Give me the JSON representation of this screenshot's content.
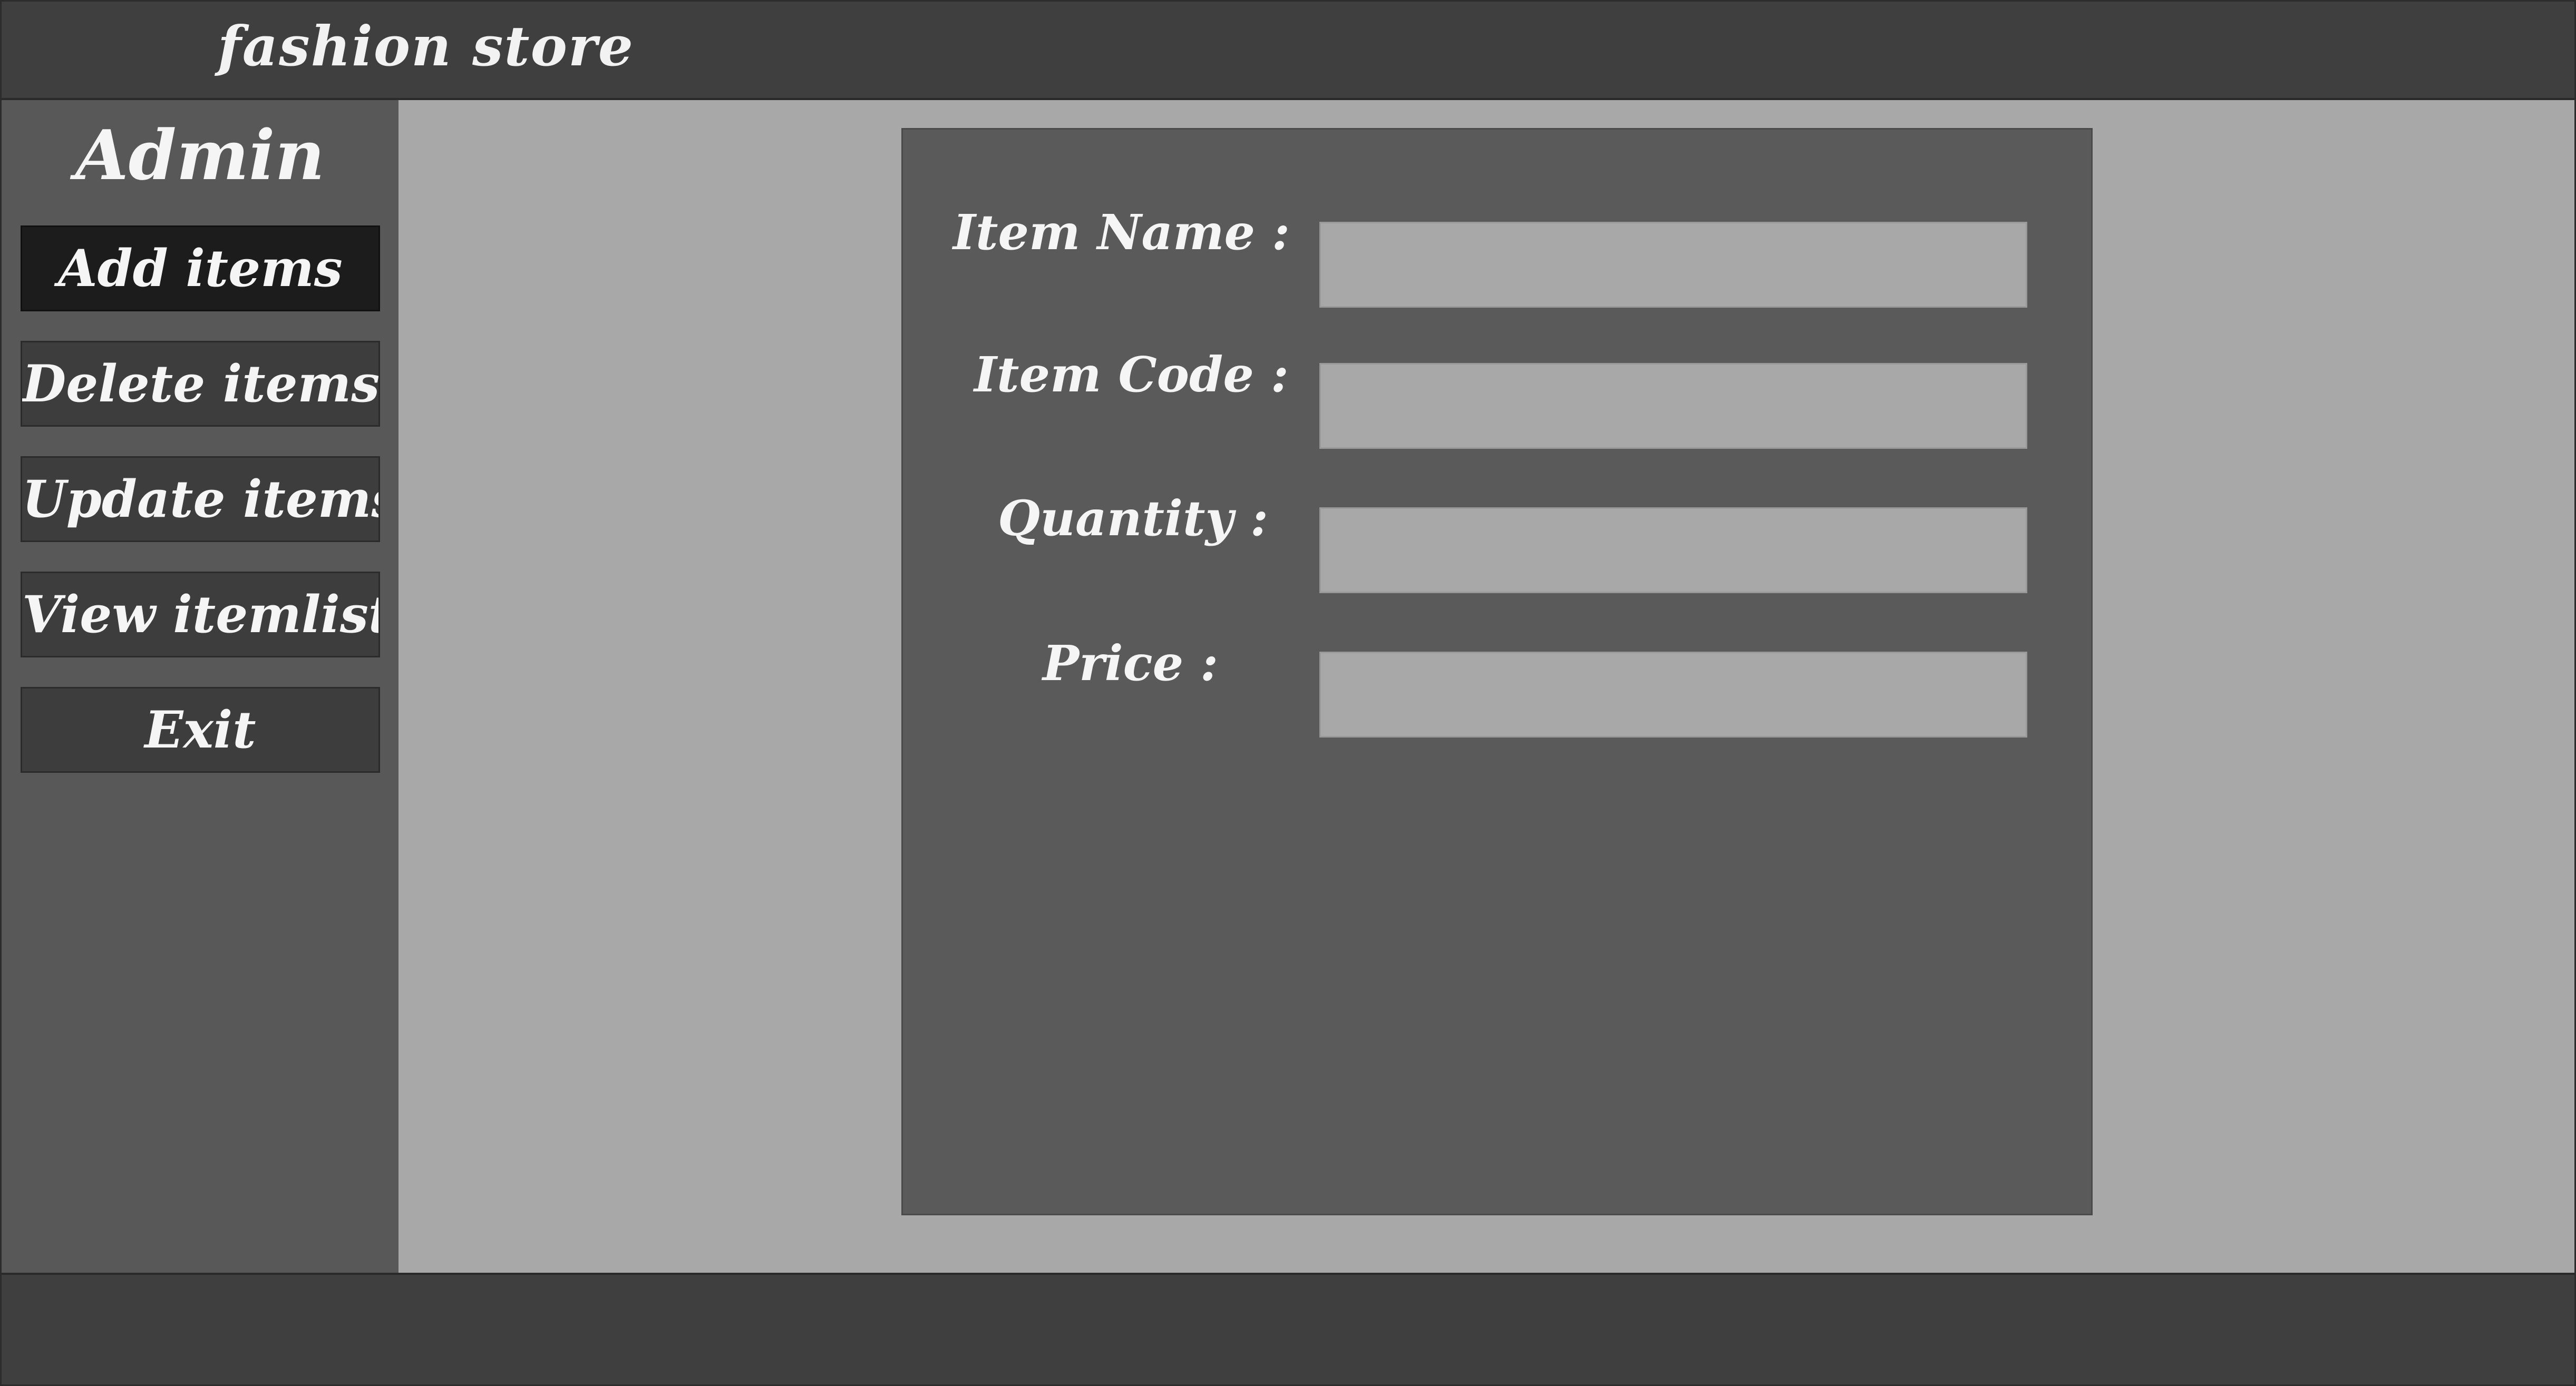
{
  "app": {
    "title": "fashion store"
  },
  "sidebar": {
    "title": "Admin",
    "items": [
      {
        "label": "Add items",
        "active": true
      },
      {
        "label": "Delete items",
        "active": false
      },
      {
        "label": "Update items",
        "active": false
      },
      {
        "label": "View itemlist",
        "active": false
      },
      {
        "label": "Exit",
        "active": false
      }
    ]
  },
  "form": {
    "fields": [
      {
        "label": "Item Name :",
        "value": "",
        "placeholder": ""
      },
      {
        "label": "Item Code :",
        "value": "",
        "placeholder": ""
      },
      {
        "label": "Quantity :",
        "value": "",
        "placeholder": ""
      },
      {
        "label": "Price :",
        "value": "",
        "placeholder": ""
      }
    ]
  },
  "colors": {
    "header_bg": "#3f3f3f",
    "sidebar_bg": "#585858",
    "active_button_bg": "#1c1c1c",
    "button_bg": "#3d3d3d",
    "content_bg": "#a8a8a8",
    "form_panel_bg": "#5a5a5a",
    "input_bg": "#a8a8a8",
    "text": "#f5f5f5"
  }
}
